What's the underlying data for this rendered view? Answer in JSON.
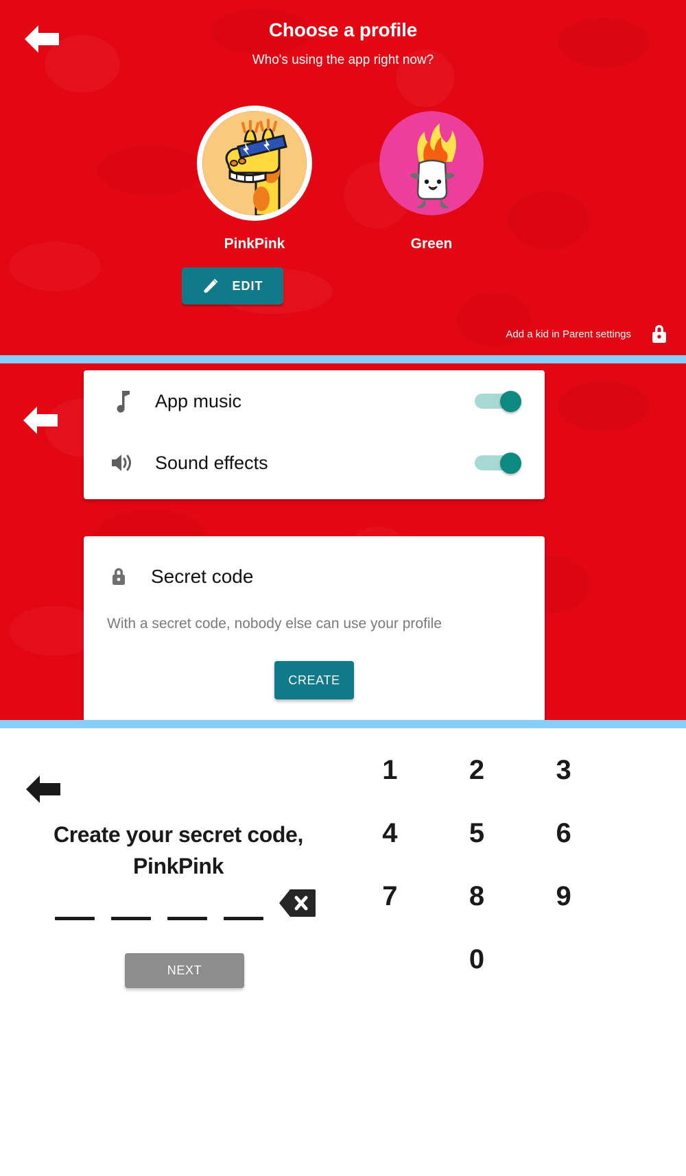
{
  "colors": {
    "red": "#e30613",
    "teal": "#10798a",
    "toggle_on": "#0d8a80",
    "divider_blue": "#87cefa",
    "next_gray": "#8d8d8d",
    "avatar1_bg": "#f9c97c",
    "avatar2_bg": "#ec3f9c"
  },
  "profile_screen": {
    "back_icon": "back-arrow-icon",
    "title": "Choose a profile",
    "subtitle": "Who's using the app right now?",
    "profiles": [
      {
        "name": "PinkPink",
        "avatar": "giraffe-sunglasses-avatar",
        "selected": true
      },
      {
        "name": "Green",
        "avatar": "flame-marshmallow-avatar",
        "selected": false
      }
    ],
    "edit_button": {
      "label": "EDIT",
      "icon": "pencil-icon"
    },
    "add_kid_text": "Add a kid in Parent settings",
    "lock_icon": "lock-icon"
  },
  "settings_screen": {
    "back_icon": "back-arrow-icon",
    "sound_card": {
      "rows": [
        {
          "label": "App music",
          "icon": "music-note-icon",
          "toggle_on": true
        },
        {
          "label": "Sound effects",
          "icon": "speaker-icon",
          "toggle_on": true
        }
      ]
    },
    "secret_card": {
      "icon": "lock-icon",
      "title": "Secret code",
      "description": "With a secret code, nobody else can use your profile",
      "create_button": "CREATE"
    }
  },
  "keypad_screen": {
    "back_icon": "back-arrow-icon",
    "title": "Create your secret code, PinkPink",
    "code_slots": 4,
    "code_value": "",
    "backspace_icon": "backspace-icon",
    "next_button": "NEXT",
    "keys": [
      "1",
      "2",
      "3",
      "4",
      "5",
      "6",
      "7",
      "8",
      "9",
      "0"
    ]
  }
}
